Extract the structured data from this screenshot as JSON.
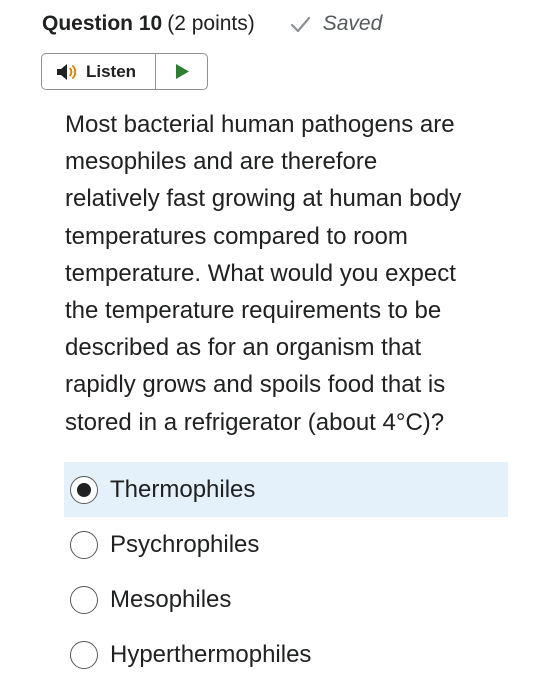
{
  "question": {
    "title": "Question 10",
    "points": "(2 points)",
    "status": "Saved",
    "status_icon": "checkmark-icon",
    "text_lines": [
      "Most bacterial human pathogens are",
      "mesophiles and are therefore",
      "relatively fast growing at human body",
      "temperatures compared to room",
      "temperature. What would you expect",
      "the temperature requirements to be",
      "described as for an organism that",
      "rapidly grows and spoils food that is",
      "stored in a refrigerator (about 4°C)?"
    ]
  },
  "listen": {
    "label": "Listen",
    "speaker_icon": "speaker-icon",
    "play_icon": "play-icon"
  },
  "options": [
    {
      "label": "Thermophiles",
      "selected": true
    },
    {
      "label": "Psychrophiles",
      "selected": false
    },
    {
      "label": "Mesophiles",
      "selected": false
    },
    {
      "label": "Hyperthermophiles",
      "selected": false
    }
  ],
  "colors": {
    "selected_background": "#e4f0fa",
    "play_green": "#2e7d32",
    "text": "#202122",
    "muted": "#565a5c"
  }
}
